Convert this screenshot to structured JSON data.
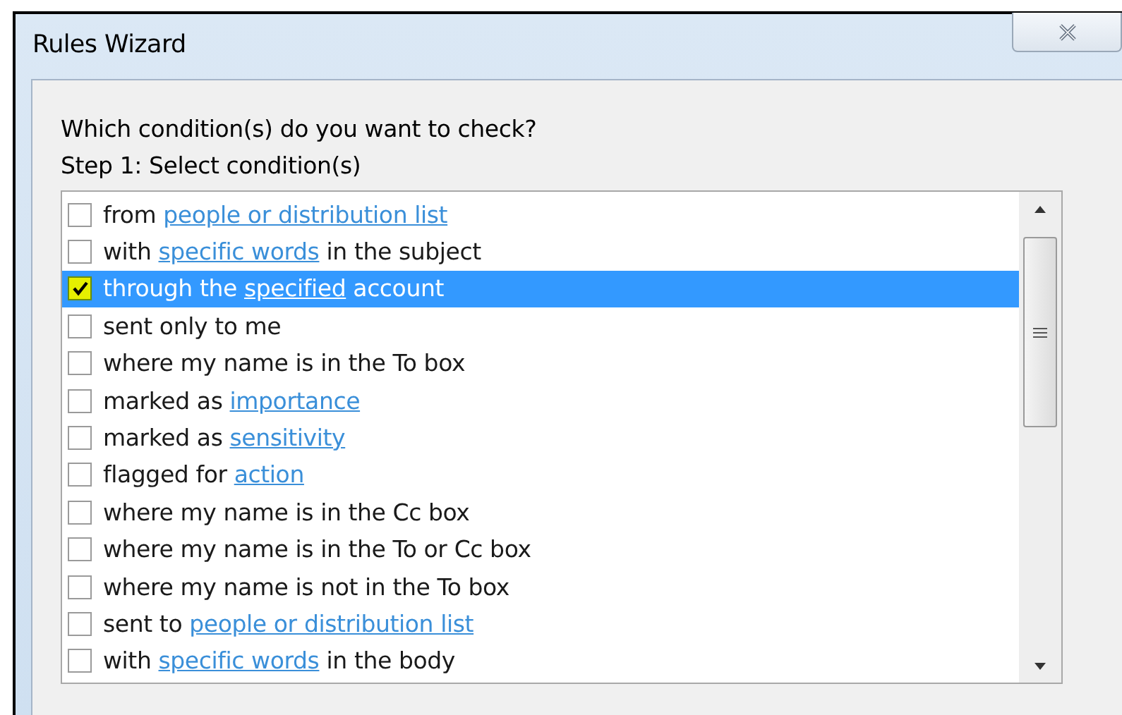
{
  "window": {
    "title": "Rules Wizard"
  },
  "prompt": "Which condition(s) do you want to check?",
  "step_label": "Step 1: Select condition(s)",
  "conditions": [
    {
      "checked": false,
      "selected": false,
      "parts": [
        {
          "text": "from "
        },
        {
          "text": "people or distribution list",
          "link": true
        }
      ]
    },
    {
      "checked": false,
      "selected": false,
      "parts": [
        {
          "text": "with "
        },
        {
          "text": "specific words",
          "link": true
        },
        {
          "text": " in the subject"
        }
      ]
    },
    {
      "checked": true,
      "selected": true,
      "parts": [
        {
          "text": "through the "
        },
        {
          "text": "specified",
          "link": true
        },
        {
          "text": " account"
        }
      ]
    },
    {
      "checked": false,
      "selected": false,
      "parts": [
        {
          "text": "sent only to me"
        }
      ]
    },
    {
      "checked": false,
      "selected": false,
      "parts": [
        {
          "text": "where my name is in the To box"
        }
      ]
    },
    {
      "checked": false,
      "selected": false,
      "parts": [
        {
          "text": "marked as "
        },
        {
          "text": "importance",
          "link": true
        }
      ]
    },
    {
      "checked": false,
      "selected": false,
      "parts": [
        {
          "text": "marked as "
        },
        {
          "text": "sensitivity",
          "link": true
        }
      ]
    },
    {
      "checked": false,
      "selected": false,
      "parts": [
        {
          "text": "flagged for "
        },
        {
          "text": "action",
          "link": true
        }
      ]
    },
    {
      "checked": false,
      "selected": false,
      "parts": [
        {
          "text": "where my name is in the Cc box"
        }
      ]
    },
    {
      "checked": false,
      "selected": false,
      "parts": [
        {
          "text": "where my name is in the To or Cc box"
        }
      ]
    },
    {
      "checked": false,
      "selected": false,
      "parts": [
        {
          "text": "where my name is not in the To box"
        }
      ]
    },
    {
      "checked": false,
      "selected": false,
      "parts": [
        {
          "text": "sent to "
        },
        {
          "text": "people or distribution list",
          "link": true
        }
      ]
    },
    {
      "checked": false,
      "selected": false,
      "parts": [
        {
          "text": "with "
        },
        {
          "text": "specific words",
          "link": true
        },
        {
          "text": " in the body"
        }
      ]
    }
  ]
}
